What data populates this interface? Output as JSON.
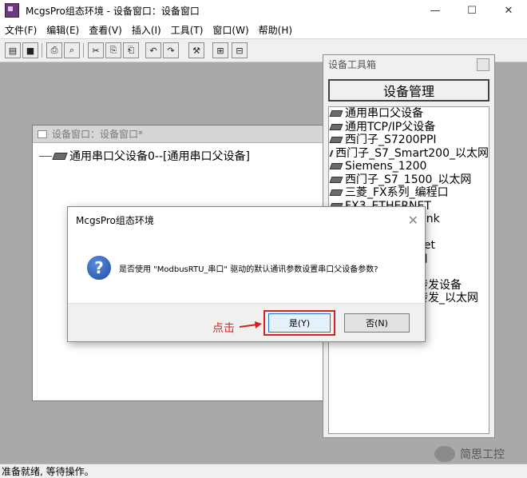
{
  "window": {
    "title": "McgsPro组态环境 - 设备窗口：设备窗口"
  },
  "window_controls": {
    "minimize": "—",
    "maximize": "☐",
    "close": "✕"
  },
  "menu": [
    "文件(F)",
    "编辑(E)",
    "查看(V)",
    "插入(I)",
    "工具(T)",
    "窗口(W)",
    "帮助(H)"
  ],
  "toolbar": {
    "icons": [
      "new-icon",
      "save-icon",
      "print-icon",
      "print-preview-icon",
      "cut-icon",
      "copy-icon",
      "paste-icon",
      "undo-icon",
      "redo-icon",
      "tools-icon",
      "window-a-icon",
      "window-b-icon"
    ],
    "glyphs": [
      "▤",
      "■",
      "⎙",
      "⌕",
      "✂",
      "⎘",
      "⎗",
      "↶",
      "↷",
      "⚒",
      "⊞",
      "⊟"
    ]
  },
  "device_window": {
    "title": "设备窗口：设备窗口*",
    "tree_item": "通用串口父设备0--[通用串口父设备]"
  },
  "toolbox": {
    "title": "设备工具箱",
    "manage_button": "设备管理",
    "items": [
      "通用串口父设备",
      "通用TCP/IP父设备",
      "西门子_S7200PPI",
      "西门子_S7_Smart200_以太网",
      "Siemens_1200",
      "西门子_S7_1500_以太网",
      "三菱_FX系列_编程口",
      "FX3_ETHERNET"
    ],
    "partial_items": [
      "Link",
      "net",
      "口",
      "转发设备",
      "转发_以太网"
    ]
  },
  "dialog": {
    "title": "McgsPro组态环境",
    "close": "✕",
    "message": "是否使用 \"ModbusRTU_串口\" 驱动的默认通讯参数设置串口父设备参数?",
    "yes_label": "是(Y)",
    "no_label": "否(N)"
  },
  "annotation": {
    "click_label": "点击",
    "highlight_color": "#d32020"
  },
  "watermark": {
    "text": "简思工控"
  },
  "status": {
    "text": "准备就绪, 等待操作。"
  }
}
